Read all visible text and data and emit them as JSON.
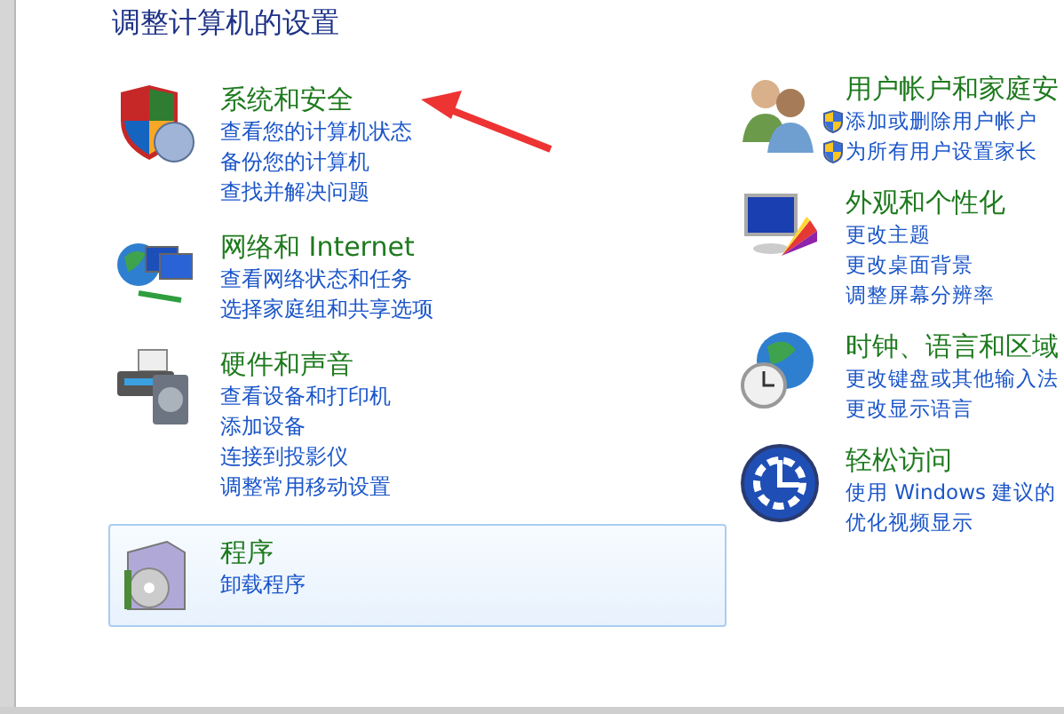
{
  "title": "调整计算机的设置",
  "columns": [
    {
      "categories": [
        {
          "kind": "security",
          "title": "系统和安全",
          "hovered": false,
          "links": [
            {
              "label": "查看您的计算机状态",
              "shield": false
            },
            {
              "label": "备份您的计算机",
              "shield": false
            },
            {
              "label": "查找并解决问题",
              "shield": false
            }
          ]
        },
        {
          "kind": "network",
          "title": "网络和 Internet",
          "hovered": false,
          "links": [
            {
              "label": "查看网络状态和任务",
              "shield": false
            },
            {
              "label": "选择家庭组和共享选项",
              "shield": false
            }
          ]
        },
        {
          "kind": "hardware",
          "title": "硬件和声音",
          "hovered": false,
          "links": [
            {
              "label": "查看设备和打印机",
              "shield": false
            },
            {
              "label": "添加设备",
              "shield": false
            },
            {
              "label": "连接到投影仪",
              "shield": false
            },
            {
              "label": "调整常用移动设置",
              "shield": false
            }
          ]
        },
        {
          "kind": "programs",
          "title": "程序",
          "hovered": true,
          "links": [
            {
              "label": "卸载程序",
              "shield": false
            }
          ]
        }
      ]
    },
    {
      "categories": [
        {
          "kind": "users",
          "title": "用户帐户和家庭安",
          "hovered": false,
          "links": [
            {
              "label": "添加或删除用户帐户",
              "shield": true
            },
            {
              "label": "为所有用户设置家长",
              "shield": true
            }
          ]
        },
        {
          "kind": "appearance",
          "title": "外观和个性化",
          "hovered": false,
          "links": [
            {
              "label": "更改主题",
              "shield": false
            },
            {
              "label": "更改桌面背景",
              "shield": false
            },
            {
              "label": "调整屏幕分辨率",
              "shield": false
            }
          ]
        },
        {
          "kind": "clock",
          "title": "时钟、语言和区域",
          "hovered": false,
          "links": [
            {
              "label": "更改键盘或其他输入法",
              "shield": false
            },
            {
              "label": "更改显示语言",
              "shield": false
            }
          ]
        },
        {
          "kind": "access",
          "title": "轻松访问",
          "hovered": false,
          "links": [
            {
              "label": "使用 Windows 建议的",
              "shield": false
            },
            {
              "label": "优化视频显示",
              "shield": false
            }
          ]
        }
      ]
    }
  ]
}
